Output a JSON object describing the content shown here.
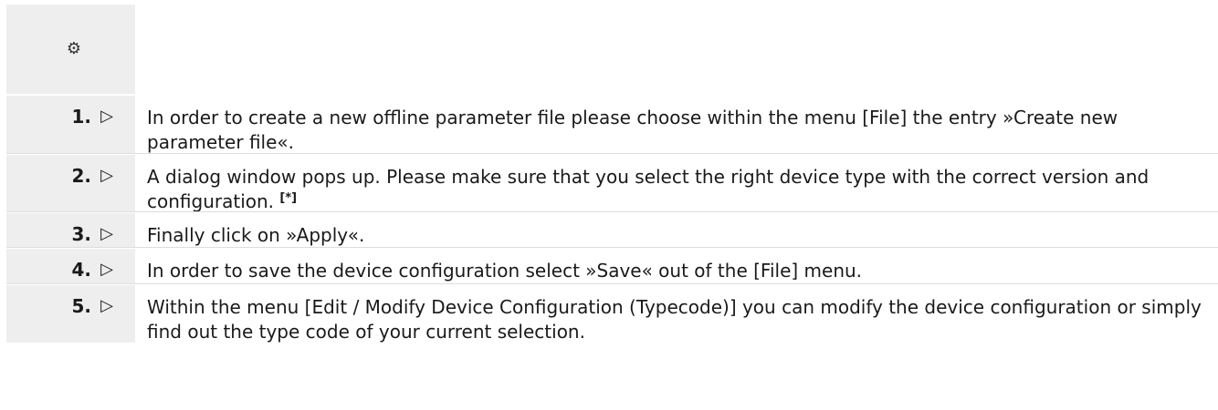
{
  "header": {
    "icon": "gear-icon",
    "icon_glyph": "⚙"
  },
  "steps": [
    {
      "number": "1.",
      "marker": "▷",
      "text": "In order to create a new offline parameter file please choose within the menu [File] the entry »Create new parameter file«."
    },
    {
      "number": "2.",
      "marker": "▷",
      "text": "A dialog window pops up. Please make sure that you select the right device type with the correct version and configuration.",
      "footnote": "[*]"
    },
    {
      "number": "3.",
      "marker": "▷",
      "text": "Finally click on »Apply«."
    },
    {
      "number": "4.",
      "marker": "▷",
      "text": "In order to save the device configuration select »Save« out of the [File] menu."
    },
    {
      "number": "5.",
      "marker": "▷",
      "text": "Within the menu [Edit / Modify Device Configuration (Typecode)] you can modify the device configuration or simply find out the type code of your current selection."
    }
  ]
}
